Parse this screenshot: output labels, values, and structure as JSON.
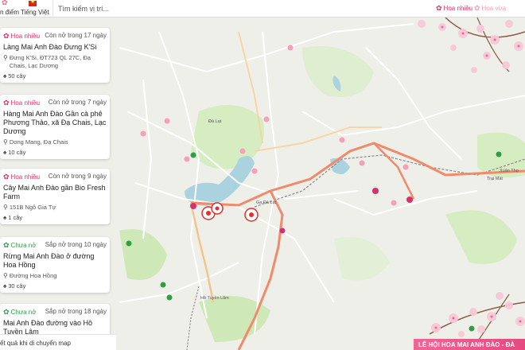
{
  "topbar": {
    "brand_text": "n điểm",
    "language": "Tiếng Việt",
    "search_placeholder": "Tìm kiếm vị trí...",
    "filters": [
      {
        "label": "Hoa nhiều",
        "color": "#d6336c"
      },
      {
        "label": "Hoa vừa",
        "color": "#f4a0b9"
      }
    ]
  },
  "places": [
    {
      "status": "Hoa nhiều",
      "status_kind": "hot",
      "bloom": "Còn nở trong 17 ngày",
      "name": "Làng Mai Anh Đào Đưng K'Si",
      "address": "Đưng K'Si, ĐT723 QL 27C, Đạ Chais, Lạc Dương",
      "trees": "50 cây"
    },
    {
      "status": "Hoa nhiều",
      "status_kind": "hot",
      "bloom": "Còn nở trong 7 ngày",
      "name": "Hàng Mai Anh Đào Gần cà phê Phương Thảo, xã Đạ Chais, Lạc Dương",
      "address": "Dong Mang, Đạ Chais",
      "trees": "10 cây"
    },
    {
      "status": "Hoa nhiều",
      "status_kind": "hot",
      "bloom": "Còn nở trong 9 ngày",
      "name": "Cây Mai Anh Đào gần Bio Fresh Farm",
      "address": "151B Ngô Gia Tự",
      "trees": "1 cây"
    },
    {
      "status": "Chưa nở",
      "status_kind": "wait",
      "bloom": "Sắp nở trong 10 ngày",
      "name": "Rừng Mai Anh Đào ở đường Hoa Hồng",
      "address": "Đường Hoa Hồng",
      "trees": "30 cây"
    },
    {
      "status": "Chưa nở",
      "status_kind": "wait",
      "bloom": "Sắp nở trong 18 ngày",
      "name": "Mai Anh Đào đường vào Hồ Tuyền Lâm",
      "address": "",
      "trees": ""
    }
  ],
  "bottom_hint": "ết quả khi di chuyển map",
  "festival_banner": "LỄ HỘI HOA MAI ANH ĐÀO - ĐÀ",
  "map_labels": [
    "Đà Lạt",
    "Ga Đà Lạt",
    "Trại Mát",
    "Xuân Thọ",
    "Hồ Tuyền Lâm"
  ],
  "colors": {
    "hot": "#d6336c",
    "medium": "#f4a0b9",
    "wait": "#2f9e44",
    "route": "#f08a6a",
    "water": "#aad3df",
    "park": "#cfe8b8"
  }
}
